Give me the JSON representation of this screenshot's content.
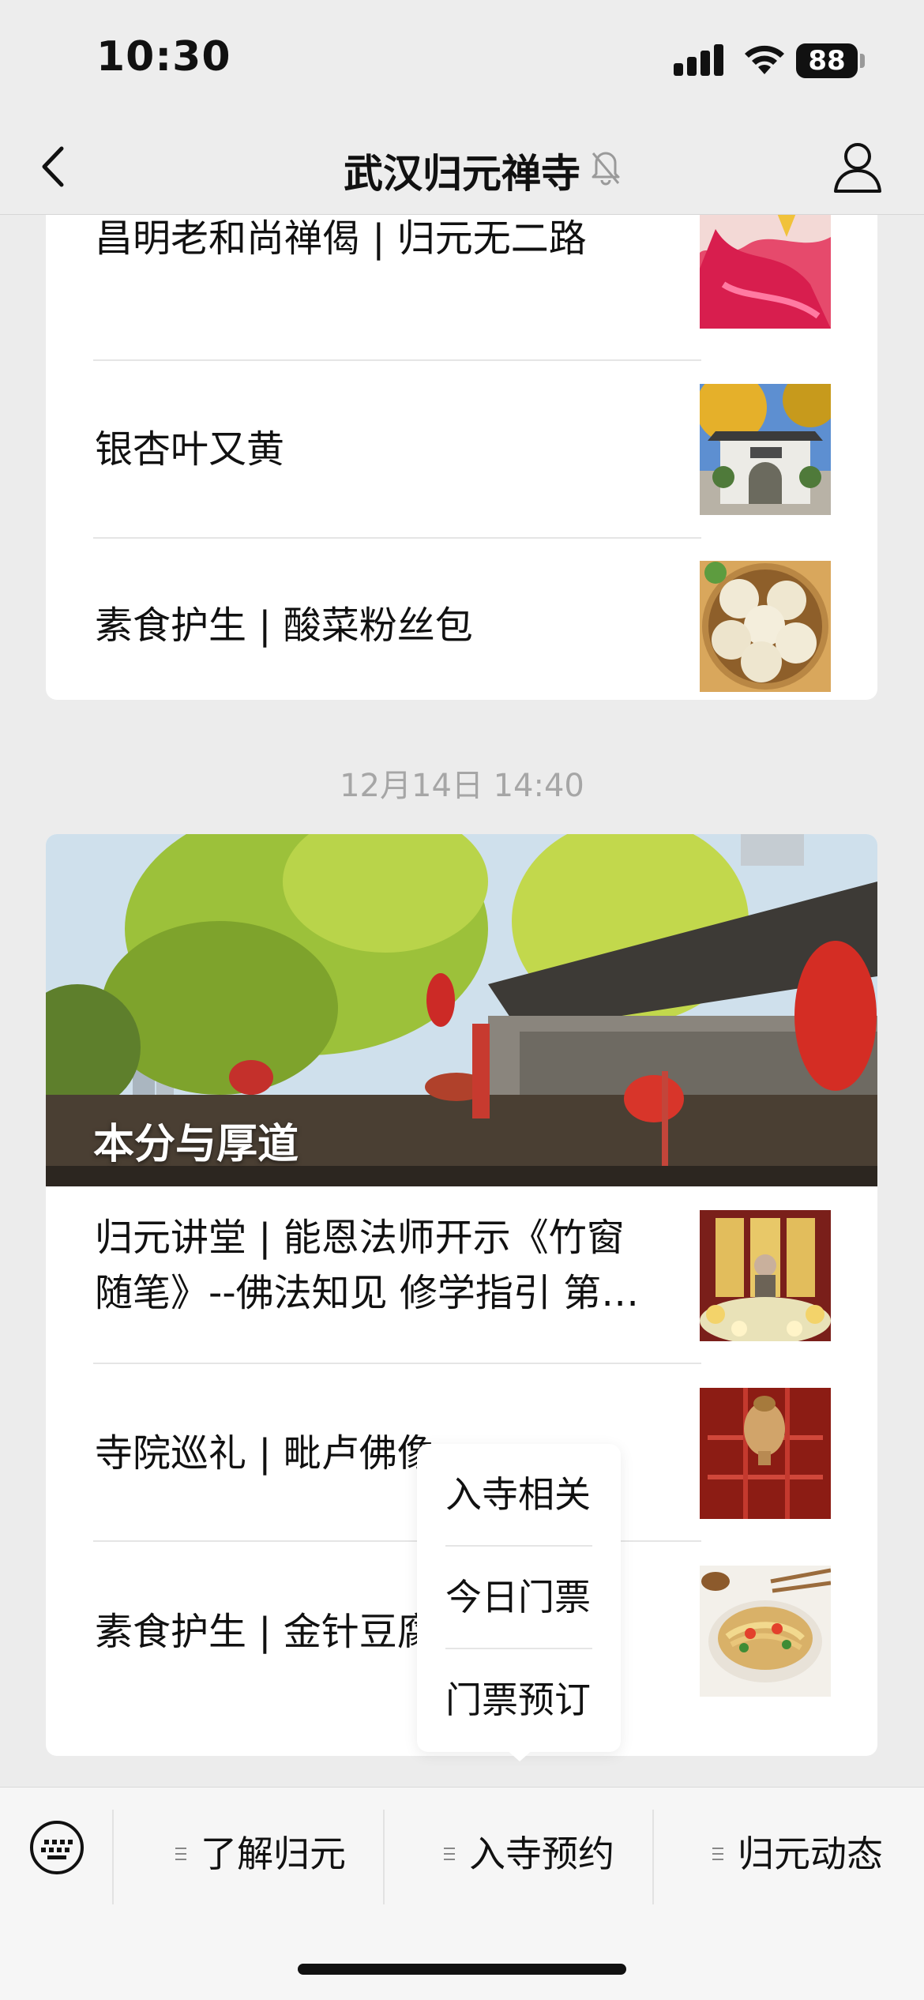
{
  "status_bar": {
    "time": "10:30",
    "battery": "88"
  },
  "nav": {
    "title": "武汉归元禅寺"
  },
  "card1": {
    "items": [
      {
        "title": "昌明老和尚禅偈 | 归元无二路",
        "thumb": "monk-robe-photo"
      },
      {
        "title": "银杏叶又黄",
        "thumb": "ginkgo-gate-photo"
      },
      {
        "title": "素食护生 | 酸菜粉丝包",
        "thumb": "steamed-buns-photo"
      }
    ]
  },
  "timestamp": "12月14日 14:40",
  "card2": {
    "hero_title": "本分与厚道",
    "items": [
      {
        "title": "归元讲堂 | 能恩法师开示《竹窗随笔》--佛法知见 修学指引 第…",
        "thumb": "dharma-talk-photo"
      },
      {
        "title": "寺院巡礼 | 毗卢佛像",
        "thumb": "buddha-statue-photo"
      },
      {
        "title": "素食护生 | 金针豆腐",
        "thumb": "tofu-dish-photo"
      }
    ]
  },
  "popup_menu": {
    "items": [
      "入寺相关",
      "今日门票",
      "门票预订"
    ]
  },
  "bottom_menu": {
    "items": [
      "了解归元",
      "入寺预约",
      "归元动态"
    ]
  },
  "colors": {
    "background": "#ececec",
    "card": "#ffffff",
    "timestamp": "#a6a6a6"
  }
}
